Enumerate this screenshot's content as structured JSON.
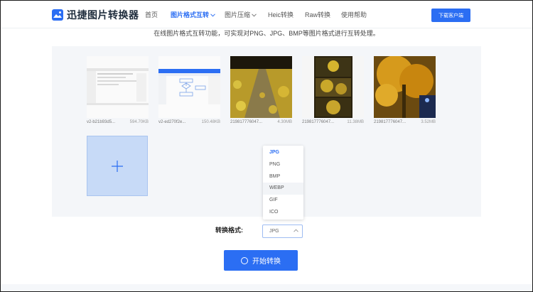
{
  "header": {
    "brand": "迅捷图片转换器",
    "nav": [
      {
        "label": "首页",
        "active": false
      },
      {
        "label": "图片格式互转",
        "active": true,
        "has_dropdown": true
      },
      {
        "label": "图片压缩",
        "active": false,
        "has_dropdown": true
      },
      {
        "label": "Heic转换",
        "active": false
      },
      {
        "label": "Raw转换",
        "active": false
      },
      {
        "label": "使用帮助",
        "active": false
      }
    ],
    "download_label": "下载客户端"
  },
  "subtitle": "在线图片格式互转功能，可实现对PNG、JPG、BMP等图片格式进行互转处理。",
  "files": [
    {
      "name": "v2-b21b93d5...",
      "size": "594.70KB",
      "thumb": "screenshot-icon"
    },
    {
      "name": "v2-ed270f2e...",
      "size": "150.48KB",
      "thumb": "flowchart-icon"
    },
    {
      "name": "219817776047...",
      "size": "4.30MB",
      "thumb": "leaf-path-photo-icon"
    },
    {
      "name": "219817776047...",
      "size": "11.38MB",
      "thumb": "ginkgo-collage-icon"
    },
    {
      "name": "219817776047...",
      "size": "3.52MB",
      "thumb": "ginkgo-tree-photo-icon"
    }
  ],
  "dropdown": {
    "options": [
      "JPG",
      "PNG",
      "BMP",
      "WEBP",
      "GIF",
      "ICO"
    ],
    "selected": "JPG",
    "hovered": "WEBP"
  },
  "format": {
    "label": "转换格式:",
    "value": "JPG"
  },
  "start_label": "开始转换",
  "colors": {
    "accent": "#2b6ef3",
    "panel": "#f4f6f9",
    "add_box": "#c7daf7"
  }
}
